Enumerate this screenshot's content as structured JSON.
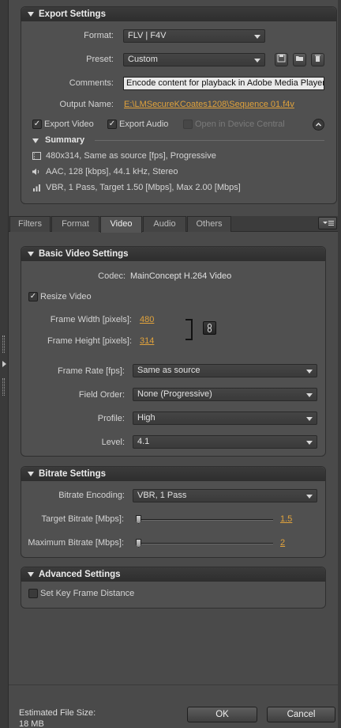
{
  "export_settings": {
    "title": "Export Settings",
    "format_label": "Format:",
    "format_value": "FLV | F4V",
    "preset_label": "Preset:",
    "preset_value": "Custom",
    "comments_label": "Comments:",
    "comments_value": "Encode content for playback in Adobe Media Player,",
    "output_label": "Output Name:",
    "output_value": "E:\\LMSecureKCoates1208\\Sequence 01.f4v",
    "export_video": "Export Video",
    "export_audio": "Export Audio",
    "open_device_central": "Open in Device Central",
    "summary_title": "Summary",
    "summary_video": "480x314, Same as source [fps], Progressive",
    "summary_audio": "AAC, 128 [kbps], 44.1 kHz, Stereo",
    "summary_bitrate": "VBR, 1 Pass, Target 1.50 [Mbps], Max 2.00 [Mbps]"
  },
  "tabs": [
    "Filters",
    "Format",
    "Video",
    "Audio",
    "Others"
  ],
  "active_tab": "Video",
  "basic_video": {
    "title": "Basic Video Settings",
    "codec_label": "Codec:",
    "codec_value": "MainConcept H.264 Video",
    "resize_video": "Resize Video",
    "frame_width_label": "Frame Width [pixels]:",
    "frame_width_value": "480",
    "frame_height_label": "Frame Height [pixels]:",
    "frame_height_value": "314",
    "frame_rate_label": "Frame Rate [fps]:",
    "frame_rate_value": "Same as source",
    "field_order_label": "Field Order:",
    "field_order_value": "None (Progressive)",
    "profile_label": "Profile:",
    "profile_value": "High",
    "level_label": "Level:",
    "level_value": "4.1"
  },
  "bitrate": {
    "title": "Bitrate Settings",
    "encoding_label": "Bitrate Encoding:",
    "encoding_value": "VBR, 1 Pass",
    "target_label": "Target Bitrate [Mbps]:",
    "target_value": "1.5",
    "max_label": "Maximum Bitrate [Mbps]:",
    "max_value": "2"
  },
  "advanced": {
    "title": "Advanced Settings",
    "key_frame": "Set Key Frame Distance"
  },
  "footer": {
    "estimated_label": "Estimated File Size:",
    "estimated_value": "18 MB",
    "ok": "OK",
    "cancel": "Cancel"
  },
  "colors": {
    "background": "#4a4a4a",
    "panel": "#505050",
    "header": "#2e2e2e",
    "link": "#e0a23c"
  },
  "icons": {
    "save_preset": "save-icon",
    "import_preset": "folder-icon",
    "delete_preset": "trash-icon",
    "collapse": "chevron-up-icon",
    "video_summary": "film-icon",
    "audio_summary": "speaker-icon",
    "bitrate_summary": "bars-icon",
    "constrain": "link-icon",
    "panel_menu": "menu-icon"
  }
}
